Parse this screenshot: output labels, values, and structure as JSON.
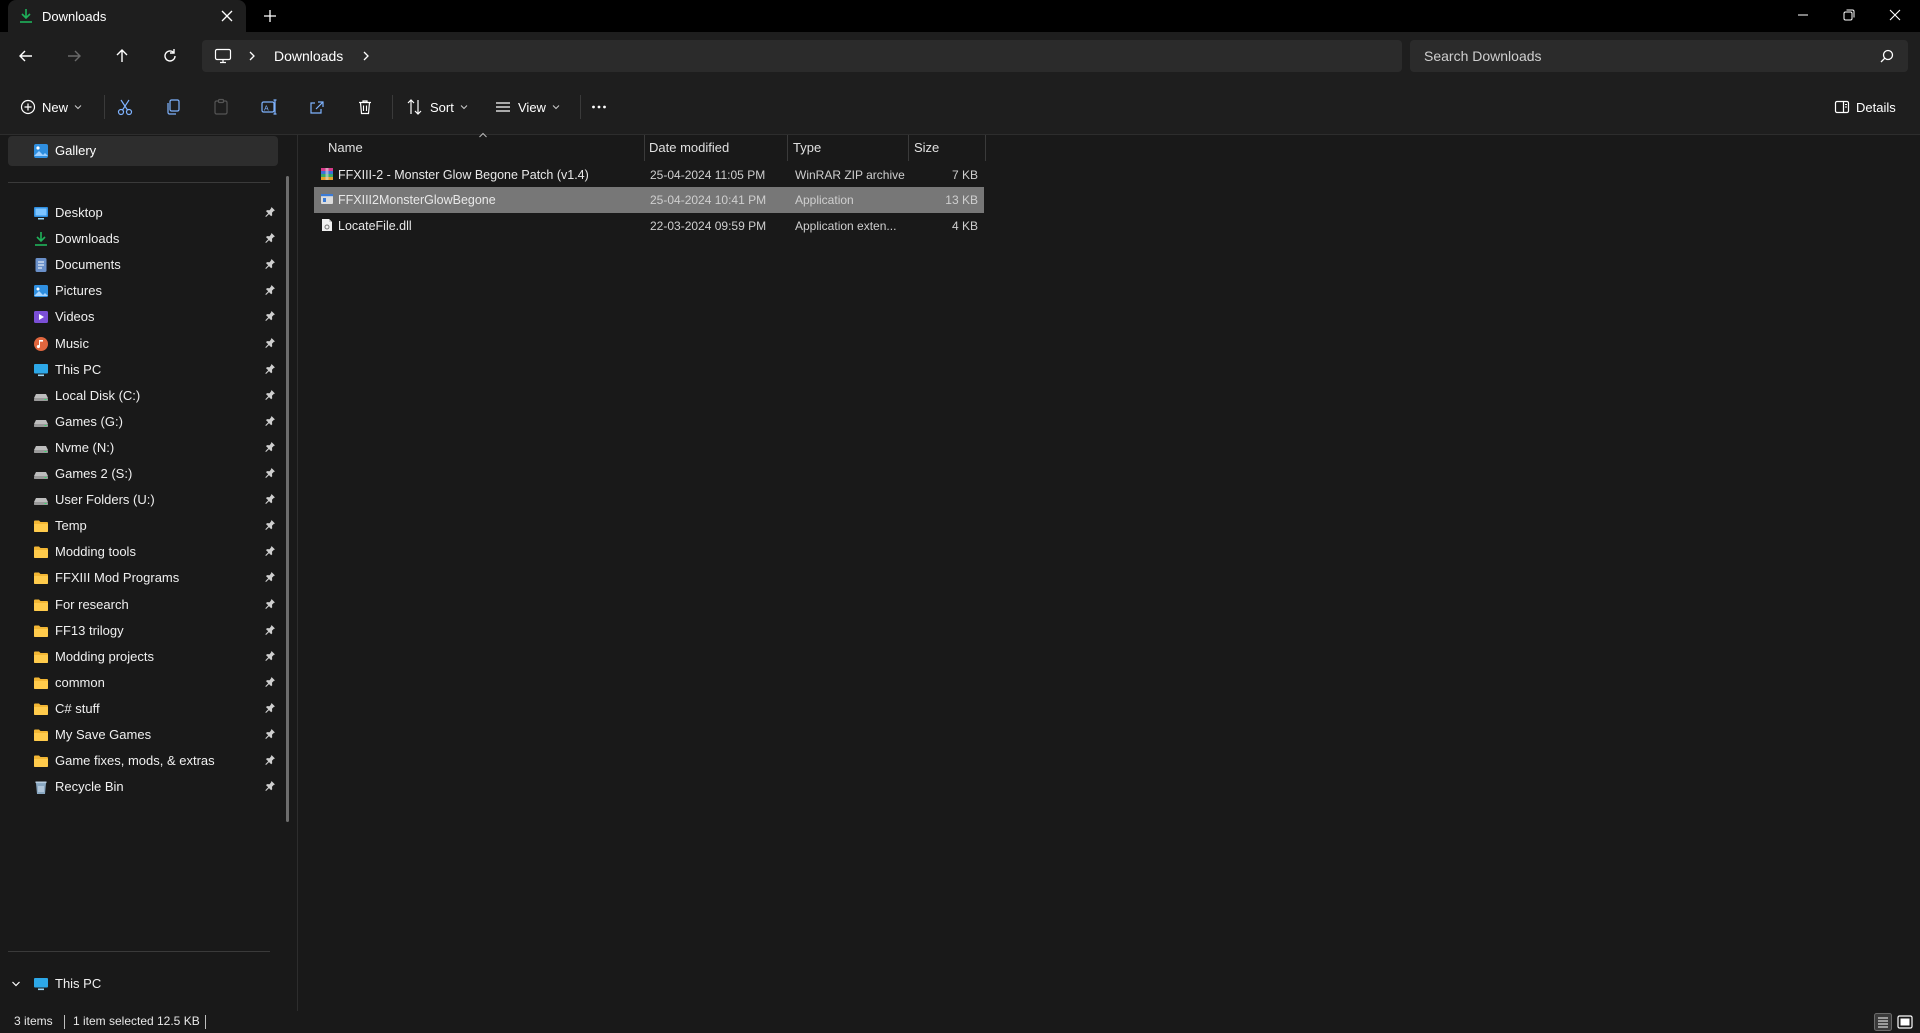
{
  "window": {
    "tab_title": "Downloads",
    "accent": "#1fb25a"
  },
  "nav": {
    "breadcrumb": "Downloads",
    "search_placeholder": "Search Downloads"
  },
  "commandbar": {
    "new_label": "New",
    "sort_label": "Sort",
    "view_label": "View",
    "details_label": "Details"
  },
  "sidebar": {
    "gallery": "Gallery",
    "items": [
      {
        "label": "Desktop",
        "icon": "desktop-icon"
      },
      {
        "label": "Downloads",
        "icon": "download-icon"
      },
      {
        "label": "Documents",
        "icon": "documents-icon"
      },
      {
        "label": "Pictures",
        "icon": "pictures-icon"
      },
      {
        "label": "Videos",
        "icon": "videos-icon"
      },
      {
        "label": "Music",
        "icon": "music-icon"
      },
      {
        "label": "This PC",
        "icon": "monitor-icon"
      },
      {
        "label": "Local Disk (C:)",
        "icon": "drive-icon"
      },
      {
        "label": "Games (G:)",
        "icon": "drive-icon"
      },
      {
        "label": "Nvme (N:)",
        "icon": "drive-icon"
      },
      {
        "label": "Games 2 (S:)",
        "icon": "drive-icon"
      },
      {
        "label": "User Folders (U:)",
        "icon": "drive-icon"
      },
      {
        "label": "Temp",
        "icon": "folder-icon"
      },
      {
        "label": "Modding tools",
        "icon": "folder-icon"
      },
      {
        "label": "FFXIII Mod Programs",
        "icon": "folder-icon"
      },
      {
        "label": "For research",
        "icon": "folder-icon"
      },
      {
        "label": "FF13 trilogy",
        "icon": "folder-icon"
      },
      {
        "label": "Modding projects",
        "icon": "folder-icon"
      },
      {
        "label": "common",
        "icon": "folder-icon"
      },
      {
        "label": "C# stuff",
        "icon": "folder-icon"
      },
      {
        "label": "My Save Games",
        "icon": "folder-icon"
      },
      {
        "label": "Game fixes, mods, & extras",
        "icon": "folder-icon"
      },
      {
        "label": "Recycle Bin",
        "icon": "recycle-bin-icon"
      }
    ],
    "this_pc": "This PC"
  },
  "filelist": {
    "columns": {
      "name": "Name",
      "date": "Date modified",
      "type": "Type",
      "size": "Size"
    },
    "rows": [
      {
        "name": "FFXIII-2 - Monster Glow Begone Patch (v1.4)",
        "date": "25-04-2024 11:05 PM",
        "type": "WinRAR ZIP archive",
        "size": "7 KB",
        "icon": "zip-archive-icon",
        "selected": false
      },
      {
        "name": "FFXIII2MonsterGlowBegone",
        "date": "25-04-2024 10:41 PM",
        "type": "Application",
        "size": "13 KB",
        "icon": "application-icon",
        "selected": true
      },
      {
        "name": "LocateFile.dll",
        "date": "22-03-2024 09:59 PM",
        "type": "Application exten...",
        "size": "4 KB",
        "icon": "dll-file-icon",
        "selected": false
      }
    ]
  },
  "status": {
    "count": "3 items",
    "selection": "1 item selected",
    "size": "12.5 KB"
  }
}
